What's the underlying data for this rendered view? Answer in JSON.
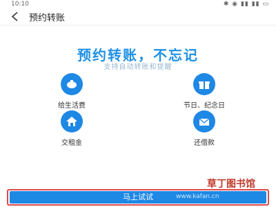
{
  "status_bar": {
    "time": "10:10",
    "icons": "✱ ◉ ▮▮ ▮▮ ▭"
  },
  "nav": {
    "title": "预约转账"
  },
  "hero": {
    "title": "预约转账，不忘记",
    "subtitle": "支持自动转账和提醒"
  },
  "options": [
    {
      "label": "给生活费"
    },
    {
      "label": "节日、纪念日"
    },
    {
      "label": "交租金"
    },
    {
      "label": "还借款"
    }
  ],
  "footer": {
    "cta_label": "马上试试",
    "cta_watermark": "www.kafan.cn",
    "site_watermark": "草丁图书馆"
  },
  "colors": {
    "accent": "#1e88e5",
    "title_blue": "#1e90e6",
    "highlight_border": "#e04848"
  }
}
